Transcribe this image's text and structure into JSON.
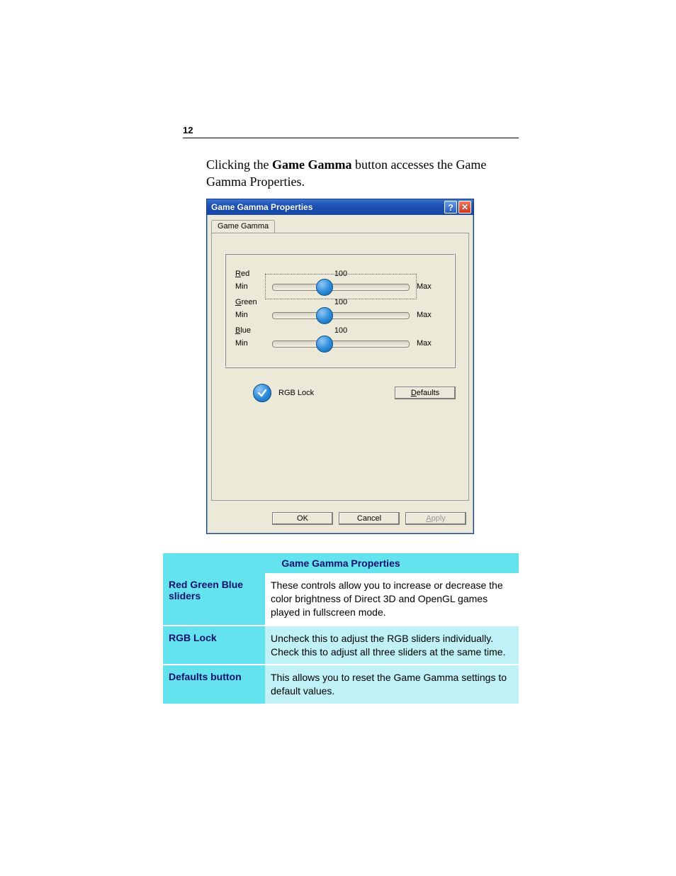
{
  "page_number": "12",
  "intro": {
    "pre": "Clicking the ",
    "bold": "Game Gamma",
    "post": " button accesses the Game Gamma Properties."
  },
  "dialog": {
    "title": "Game Gamma Properties",
    "tab_label": "Game Gamma",
    "sliders": {
      "red": {
        "label_letter": "R",
        "label_rest": "ed",
        "value": "100",
        "min": "Min",
        "max": "Max",
        "thumb_pct": 38
      },
      "green": {
        "label_letter": "G",
        "label_rest": "reen",
        "value": "100",
        "min": "Min",
        "max": "Max",
        "thumb_pct": 38
      },
      "blue": {
        "label_letter": "B",
        "label_rest": "lue",
        "value": "100",
        "min": "Min",
        "max": "Max",
        "thumb_pct": 38
      }
    },
    "rgb_lock_label": "RGB Lock",
    "defaults_letter": "D",
    "defaults_rest": "efaults",
    "ok": "OK",
    "cancel": "Cancel",
    "apply_letter": "A",
    "apply_rest": "pply"
  },
  "table": {
    "header": "Game Gamma Properties",
    "rows": [
      {
        "name": "Red Green Blue sliders",
        "desc": "These controls allow you to increase or decrease the color brightness of Direct 3D and OpenGL games played in fullscreen mode."
      },
      {
        "name": "RGB Lock",
        "desc": "Uncheck this to adjust the RGB sliders individually. Check this to adjust all three sliders at the same time."
      },
      {
        "name": "Defaults button",
        "desc": "This allows you to reset the Game Gamma settings to default values."
      }
    ]
  }
}
